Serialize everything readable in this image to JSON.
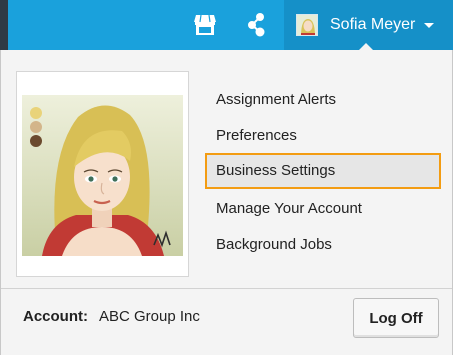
{
  "header": {
    "icons": [
      "store-icon",
      "share-icon"
    ],
    "user_name": "Sofia Meyer",
    "colors": {
      "bar": "#1aa1dc",
      "user_menu": "#1590c8"
    }
  },
  "dropdown": {
    "menu_items": [
      {
        "label": "Assignment Alerts"
      },
      {
        "label": "Preferences"
      },
      {
        "label": "Business Settings",
        "highlighted": true
      },
      {
        "label": "Manage Your Account"
      },
      {
        "label": "Background Jobs"
      }
    ],
    "highlight_color": "#f39c12",
    "account_label": "Account:",
    "account_value": "ABC Group Inc",
    "logoff_label": "Log Off"
  }
}
